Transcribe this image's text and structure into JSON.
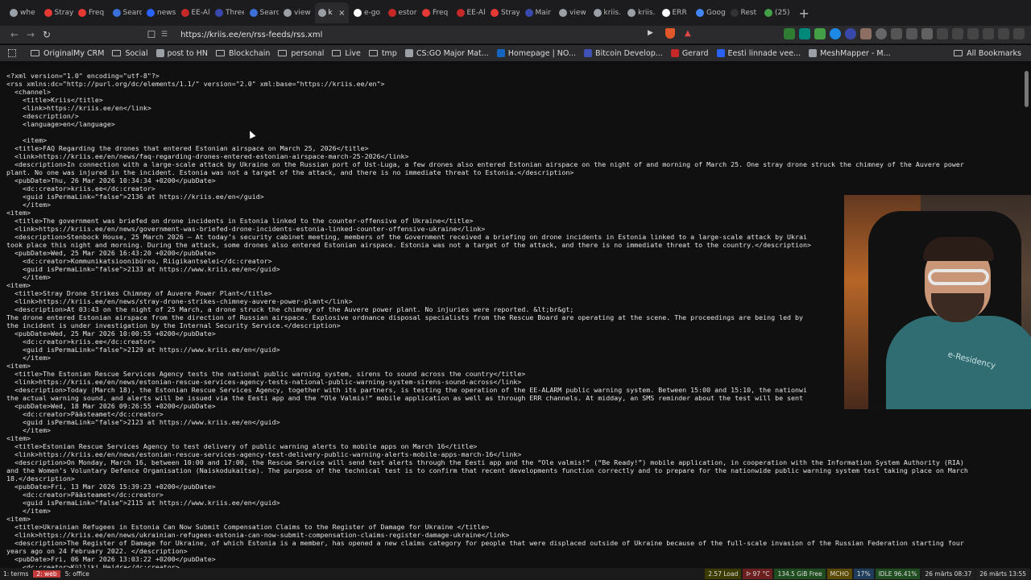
{
  "tabs": [
    {
      "label": "whe",
      "fav": "#9aa0a6"
    },
    {
      "label": "Stray",
      "fav": "#e53935"
    },
    {
      "label": "Freq",
      "fav": "#e53935"
    },
    {
      "label": "Searc",
      "fav": "#3c6fd8"
    },
    {
      "label": "news",
      "fav": "#2962ff"
    },
    {
      "label": "EE-Al",
      "fav": "#c62828"
    },
    {
      "label": "Three",
      "fav": "#3949ab"
    },
    {
      "label": "Searc",
      "fav": "#3c6fd8"
    },
    {
      "label": "view",
      "fav": "#9aa0a6"
    },
    {
      "label": "k",
      "fav": "#9aa0a6",
      "active": true
    },
    {
      "label": "e-go",
      "fav": "#ffffff"
    },
    {
      "label": "estor",
      "fav": "#c62828"
    },
    {
      "label": "Freq",
      "fav": "#e53935"
    },
    {
      "label": "EE-Al",
      "fav": "#c62828"
    },
    {
      "label": "Stray",
      "fav": "#e53935"
    },
    {
      "label": "Mair",
      "fav": "#3949ab"
    },
    {
      "label": "view",
      "fav": "#9aa0a6"
    },
    {
      "label": "kriis.",
      "fav": "#9aa0a6"
    },
    {
      "label": "kriis.",
      "fav": "#9aa0a6"
    },
    {
      "label": "ERR",
      "fav": "#ffffff"
    },
    {
      "label": "Goog",
      "fav": "#4285f4"
    },
    {
      "label": "Rest",
      "fav": "#333333"
    },
    {
      "label": "(25)",
      "fav": "#43a047"
    }
  ],
  "toolbar": {
    "url": "https://kriis.ee/en/rss-feeds/rss.xml"
  },
  "bookmarks": [
    {
      "label": "OriginalMy CRM",
      "type": "folder"
    },
    {
      "label": "Social",
      "type": "folder"
    },
    {
      "label": "post to HN",
      "type": "link",
      "color": "#9aa0a6"
    },
    {
      "label": "Blockchain",
      "type": "folder"
    },
    {
      "label": "personal",
      "type": "folder"
    },
    {
      "label": "Live",
      "type": "folder"
    },
    {
      "label": "tmp",
      "type": "folder"
    },
    {
      "label": "CS:GO Major Mat...",
      "type": "link",
      "color": "#9aa0a6"
    },
    {
      "label": "Homepage | NO...",
      "type": "link",
      "color": "#1565c0"
    },
    {
      "label": "Bitcoin Develop...",
      "type": "link",
      "color": "#3f51b5"
    },
    {
      "label": "Gerard",
      "type": "link",
      "color": "#c62828"
    },
    {
      "label": "Eesti linnade vee...",
      "type": "link",
      "color": "#2962ff"
    },
    {
      "label": "MeshMapper - M...",
      "type": "link",
      "color": "#9aa0a6"
    }
  ],
  "all_bookmarks": "All Bookmarks",
  "xml_lines": [
    "<?xml version=\"1.0\" encoding=\"utf-8\"?>",
    "<rss xmlns:dc=\"http://purl.org/dc/elements/1.1/\" version=\"2.0\" xml:base=\"https://kriis.ee/en\">",
    "  <channel>",
    "    <title>Kriis</title>",
    "    <link>https://kriis.ee/en</link>",
    "    <description/>",
    "    <language>en</language>",
    "",
    "    <item>",
    "  <title>FAQ Regarding the drones that entered Estonian airspace on March 25, 2026</title>",
    "  <link>https://kriis.ee/en/news/faq-regarding-drones-entered-estonian-airspace-march-25-2026</link>",
    "  <description>In connection with a large-scale attack by Ukraine on the Russian port of Ust-Luga, a few drones also entered Estonian airspace on the night of and morning of March 25. One stray drone struck the chimney of the Auvere power",
    "plant. No one was injured in the incident. Estonia was not a target of the attack, and there is no immediate threat to Estonia.</description>",
    "  <pubDate>Thu, 26 Mar 2026 10:34:34 +0200</pubDate>",
    "    <dc:creator>kriis.ee</dc:creator>",
    "    <guid isPermaLink=\"false\">2136 at https://kriis.ee/en</guid>",
    "    </item>",
    "<item>",
    "  <title>The government was briefed on drone incidents in Estonia linked to the counter-offensive of Ukraine</title>",
    "  <link>https://kriis.ee/en/news/government-was-briefed-drone-incidents-estonia-linked-counter-offensive-ukraine</link>",
    "  <description>Stenbock House, 25 March 2026 – At today’s security cabinet meeting, members of the Government received a briefing on drone incidents in Estonia linked to a large-scale attack by Ukrai",
    "took place this night and morning. During the attack, some drones also entered Estonian airspace. Estonia was not a target of the attack, and there is no immediate threat to the country.</description>",
    "  <pubDate>Wed, 25 Mar 2026 16:43:20 +0200</pubDate>",
    "    <dc:creator>Kommunikatsioonibüroo, Riigikantselei</dc:creator>",
    "    <guid isPermaLink=\"false\">2133 at https://www.kriis.ee/en</guid>",
    "    </item>",
    "<item>",
    "  <title>Stray Drone Strikes Chimney of Auvere Power Plant</title>",
    "  <link>https://kriis.ee/en/news/stray-drone-strikes-chimney-auvere-power-plant</link>",
    "  <description>At 03:43 on the night of 25 March, a drone struck the chimney of the Auvere power plant. No injuries were reported. &lt;br&gt;",
    "The drone entered Estonian airspace from the direction of Russian airspace. Explosive ordnance disposal specialists from the Rescue Board are operating at the scene. The proceedings are being led by",
    "the incident is under investigation by the Internal Security Service.</description>",
    "  <pubDate>Wed, 25 Mar 2026 10:00:55 +0200</pubDate>",
    "    <dc:creator>kriis.ee</dc:creator>",
    "    <guid isPermaLink=\"false\">2129 at https://www.kriis.ee/en</guid>",
    "    </item>",
    "<item>",
    "  <title>The Estonian Rescue Services Agency tests the national public warning system, sirens to sound across the country</title>",
    "  <link>https://kriis.ee/en/news/estonian-rescue-services-agency-tests-national-public-warning-system-sirens-sound-across</link>",
    "  <description>Today (March 18), the Estonian Rescue Services Agency, together with its partners, is testing the operation of the EE-ALARM public warning system. Between 15:00 and 15:10, the nationwi",
    "the actual warning sound, and alerts will be issued via the Eesti app and the “Ole Valmis!” mobile application as well as through ERR channels. At midday, an SMS reminder about the test will be sent",
    "  <pubDate>Wed, 18 Mar 2026 09:26:55 +0200</pubDate>",
    "    <dc:creator>Päästeamet</dc:creator>",
    "    <guid isPermaLink=\"false\">2123 at https://www.kriis.ee/en</guid>",
    "    </item>",
    "<item>",
    "  <title>Estonian Rescue Services Agency to test delivery of public warning alerts to mobile apps on March 16</title>",
    "  <link>https://kriis.ee/en/news/estonian-rescue-services-agency-test-delivery-public-warning-alerts-mobile-apps-march-16</link>",
    "  <description>On Monday, March 16, between 10:00 and 17:00, the Rescue Service will send test alerts through the Eesti app and the “Ole valmis!” (“Be Ready!”) mobile application, in cooperation with the Information System Authority (RIA)",
    "and the Women’s Voluntary Defence Organisation (Naiskodukaitse). The purpose of the technical test is to confirm that recent developments function correctly and to prepare for the nationwide public warning system test taking place on March",
    "18.</description>",
    "  <pubDate>Fri, 13 Mar 2026 15:39:23 +0200</pubDate>",
    "    <dc:creator>Päästeamet</dc:creator>",
    "    <guid isPermaLink=\"false\">2115 at https://www.kriis.ee/en</guid>",
    "    </item>",
    "<item>",
    "  <title>Ukrainian Refugees in Estonia Can Now Submit Compensation Claims to the Register of Damage for Ukraine </title>",
    "  <link>https://kriis.ee/en/news/ukrainian-refugees-estonia-can-now-submit-compensation-claims-register-damage-ukraine</link>",
    "  <description>The Register of Damage for Ukraine, of which Estonia is a member, has opened a new claims category for people that were displaced outside of Ukraine because of the full-scale invasion of the Russian Federation starting four",
    "years ago on 24 February 2022. </description>",
    "  <pubDate>Fri, 06 Mar 2026 13:03:22 +0200</pubDate>",
    "    <dc:creator>Külliki Heidra</dc:creator>"
  ],
  "webcam": {
    "shirt_text": "e-Residency"
  },
  "statusbar": {
    "left": [
      "1: terms",
      "2: web",
      "5: office"
    ],
    "right": [
      "2.57 Load",
      "ᐅ 97 °C",
      "134.5 GiB Free",
      "MCHO",
      "17%",
      "IDLE 96.41%",
      "26 märts 08:37",
      "26 märts 13:55"
    ]
  },
  "colors": {
    "accent_red": "#c53a3a",
    "xml_text": "#e4e4e4",
    "background": "#101010"
  }
}
